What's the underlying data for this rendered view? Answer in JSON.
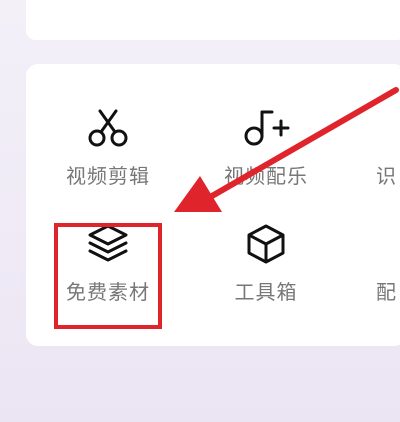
{
  "tools": [
    {
      "label": "视频剪辑",
      "icon": "scissors-icon"
    },
    {
      "label": "视频配乐",
      "icon": "music-note-plus-icon"
    },
    {
      "label": "识",
      "icon": ""
    },
    {
      "label": "免费素材",
      "icon": "layers-icon"
    },
    {
      "label": "工具箱",
      "icon": "box-icon"
    },
    {
      "label": "配",
      "icon": ""
    }
  ],
  "annotation": {
    "color": "#e0242b",
    "target": "免费素材"
  }
}
